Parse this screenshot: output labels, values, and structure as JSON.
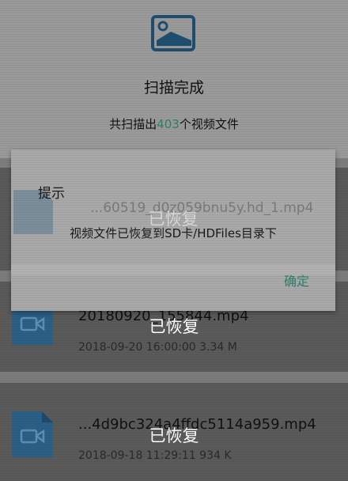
{
  "header": {
    "icon": "image-icon",
    "title": "扫描完成",
    "summary_prefix": "共扫描出",
    "summary_count": "403",
    "summary_suffix": "个视频文件"
  },
  "dialog": {
    "title": "提示",
    "message": "视频文件已恢复到SD卡/HDFiles目录下",
    "ok_label": "确定",
    "behind_item_name": "...60519_d0z059bnu5y.hd_1.mp4",
    "behind_restored": "已恢复"
  },
  "files": [
    {
      "name": "20180920_155844.mp4",
      "date": "2018-09-20 16:00:00",
      "size": "3.34 M",
      "status": "已恢复",
      "icon": "video-file-icon"
    },
    {
      "name": "...4d9bc324a4ffdc5114a959.mp4",
      "date": "2018-09-18 11:29:11",
      "size": "934 K",
      "status": "已恢复",
      "icon": "video-file-icon"
    }
  ],
  "colors": {
    "accent": "#2f7e6a",
    "file_icon": "#2b5f86"
  }
}
